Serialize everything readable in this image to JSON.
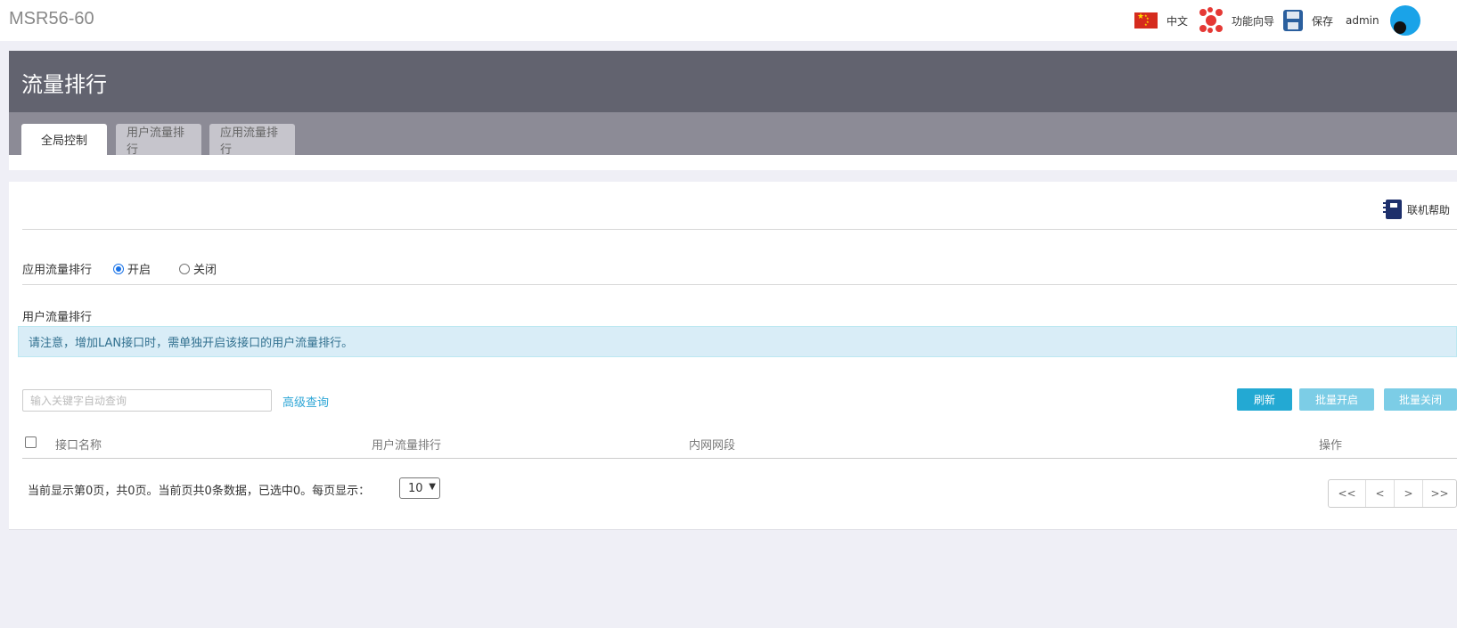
{
  "header": {
    "brand": "MSR56-60",
    "language": "中文",
    "wizard": "功能向导",
    "save": "保存",
    "user": "admin"
  },
  "page": {
    "title": "流量排行",
    "tabs": [
      {
        "label": "全局控制",
        "active": true
      },
      {
        "label": "用户流量排行",
        "active": false
      },
      {
        "label": "应用流量排行",
        "active": false
      }
    ]
  },
  "panel": {
    "help": "联机帮助",
    "app_rank_label": "应用流量排行",
    "radio_on": "开启",
    "radio_off": "关闭",
    "radio_selected": "开启",
    "user_rank_label": "用户流量排行",
    "notice": "请注意，增加LAN接口时，需单独开启该接口的用户流量排行。",
    "search_placeholder": "输入关键字自动查询",
    "advanced_query": "高级查询",
    "buttons": {
      "refresh": "刷新",
      "batch_enable": "批量开启",
      "batch_disable": "批量关闭"
    },
    "table": {
      "columns": [
        "接口名称",
        "用户流量排行",
        "内网网段",
        "操作"
      ],
      "rows": []
    },
    "pagination": {
      "info": "当前显示第0页，共0页。当前页共0条数据，已选中0。每页显示：",
      "page_size": "10",
      "first": "<<",
      "prev": "<",
      "next": ">",
      "last": ">>"
    }
  },
  "colors": {
    "page_header": "#62636f",
    "tab_bar": "#8c8b96",
    "primary_button": "#23a9d3",
    "notice_bg": "#d9edf7",
    "link": "#2ea6d6"
  }
}
